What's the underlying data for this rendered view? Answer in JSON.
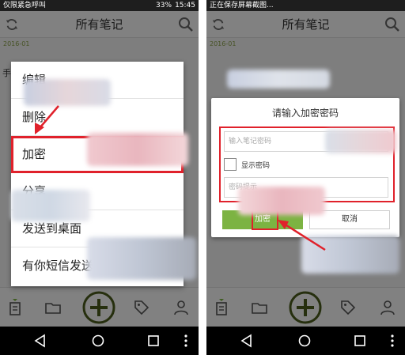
{
  "left_phone": {
    "status": {
      "left": "仅限紧急呼叫",
      "right": "33%",
      "time": "15:45"
    },
    "appbar_title": "所有笔记",
    "section_date": "2016-01",
    "note_fragment": "手",
    "context_menu": {
      "items": [
        "编辑",
        "删除",
        "加密",
        "分享",
        "发送到桌面",
        "有你短信发送"
      ],
      "highlighted_index": 2
    }
  },
  "right_phone": {
    "status": {
      "left": "正在保存屏幕截图..."
    },
    "appbar_title": "所有笔记",
    "section_date": "2016-01",
    "dialog": {
      "title": "请输入加密密码",
      "password_placeholder": "输入笔记密码",
      "show_password_label": "显示密码",
      "hint_placeholder": "密码提示",
      "encrypt_label": "加密",
      "cancel_label": "取消"
    }
  },
  "colors": {
    "accent_green": "#7cb342",
    "highlight_red": "#e0212b",
    "icon_olive": "#4a5a1c"
  },
  "icons": [
    "sync-icon",
    "search-icon",
    "note-icon",
    "folder-icon",
    "add-note-icon",
    "tag-icon",
    "profile-icon",
    "back-icon",
    "home-icon",
    "recents-icon",
    "more-icon"
  ]
}
